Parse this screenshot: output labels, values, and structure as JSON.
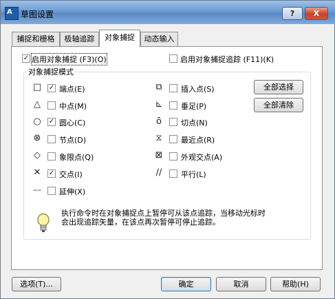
{
  "window": {
    "title": "草图设置"
  },
  "title_buttons": {
    "help": "?",
    "close": "X"
  },
  "tabs": [
    {
      "label": "捕捉和栅格"
    },
    {
      "label": "极轴追踪"
    },
    {
      "label": "对象捕捉",
      "active": true
    },
    {
      "label": "动态输入"
    }
  ],
  "snap_on": {
    "label": "启用对象捕捉 (F3)(O)",
    "checked": true
  },
  "track_on": {
    "label": "启用对象捕捉追踪 (F11)(K)",
    "checked": false
  },
  "modes_group": {
    "title": "对象捕捉模式"
  },
  "left_modes": [
    {
      "label": "端点(E)",
      "checked": true,
      "icon": "endpoint-icon"
    },
    {
      "label": "中点(M)",
      "checked": false,
      "icon": "midpoint-icon"
    },
    {
      "label": "圆心(C)",
      "checked": true,
      "icon": "center-icon"
    },
    {
      "label": "节点(D)",
      "checked": false,
      "icon": "node-icon"
    },
    {
      "label": "象限点(Q)",
      "checked": false,
      "icon": "quadrant-icon"
    },
    {
      "label": "交点(I)",
      "checked": true,
      "icon": "intersection-icon"
    },
    {
      "label": "延伸(X)",
      "checked": false,
      "icon": "extension-icon"
    }
  ],
  "right_modes": [
    {
      "label": "插入点(S)",
      "checked": false,
      "icon": "insertion-icon"
    },
    {
      "label": "垂足(P)",
      "checked": false,
      "icon": "perpendicular-icon"
    },
    {
      "label": "切点(N)",
      "checked": false,
      "icon": "tangent-icon"
    },
    {
      "label": "最近点(R)",
      "checked": false,
      "icon": "nearest-icon"
    },
    {
      "label": "外观交点(A)",
      "checked": false,
      "icon": "apparent-intersection-icon"
    },
    {
      "label": "平行(L)",
      "checked": false,
      "icon": "parallel-icon"
    }
  ],
  "select_all": "全部选择",
  "clear_all": "全部清除",
  "hint": {
    "line1": "执行命令时在对象捕捉点上暂停可从该点追踪，当移动光标时",
    "line2": "会出现追踪矢量，在该点再次暂停可停止追踪。"
  },
  "footer": {
    "options": "选项(T)...",
    "ok": "确定",
    "cancel": "取消",
    "help": "帮助(H)"
  }
}
